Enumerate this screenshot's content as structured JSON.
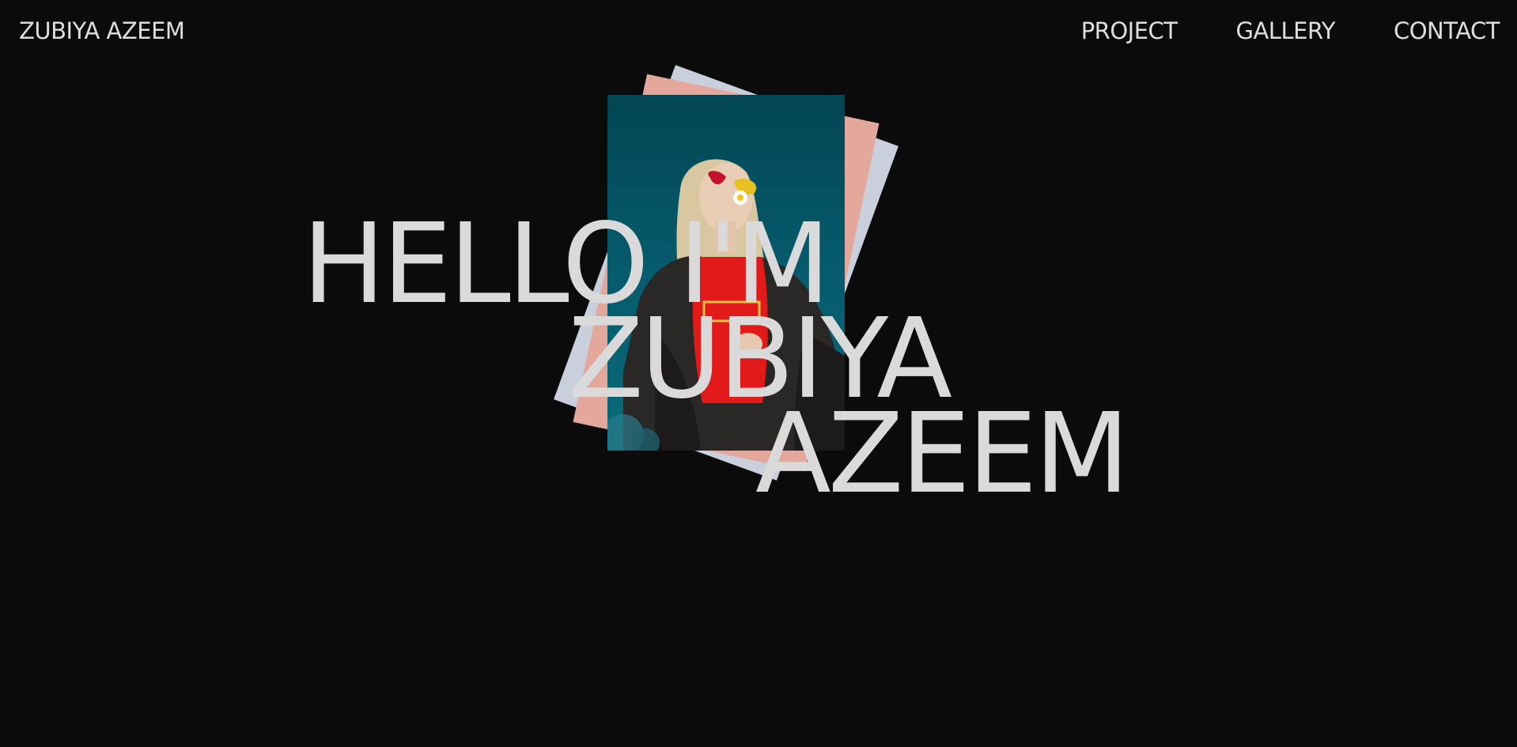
{
  "header": {
    "logo_text": "ZUBIYA AZEEM",
    "nav": [
      {
        "label": "PROJECT"
      },
      {
        "label": "GALLERY"
      },
      {
        "label": "CONTACT"
      }
    ]
  },
  "hero": {
    "lines": [
      "HELLO I'M",
      "ZUBIYA",
      "AZEEM"
    ]
  },
  "colors": {
    "background": "#0b0b0b",
    "text": "#dadada",
    "card_pink": "#e3a79b",
    "card_blue": "#c9cfdb",
    "photo_teal": "#05596a",
    "shirt_red": "#e31a1a"
  }
}
